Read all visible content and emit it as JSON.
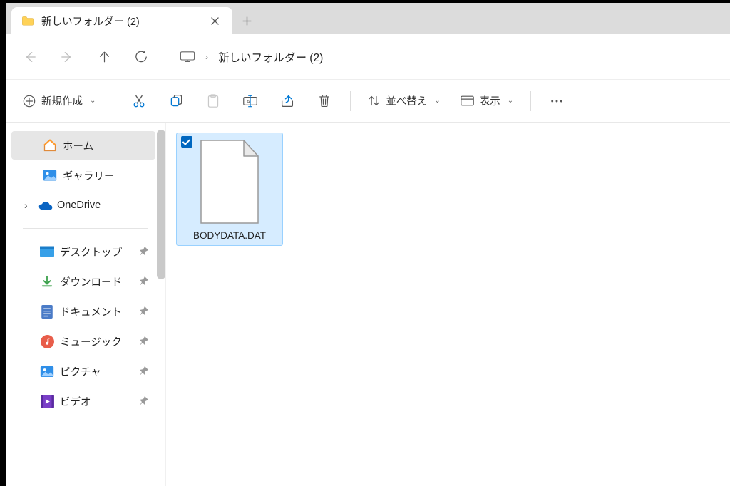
{
  "tab": {
    "title": "新しいフォルダー (2)"
  },
  "breadcrumb": {
    "current": "新しいフォルダー (2)"
  },
  "toolbar": {
    "new": "新規作成",
    "sort": "並べ替え",
    "view": "表示"
  },
  "sidebar": {
    "home": "ホーム",
    "gallery": "ギャラリー",
    "onedrive": "OneDrive",
    "quick": [
      {
        "label": "デスクトップ"
      },
      {
        "label": "ダウンロード"
      },
      {
        "label": "ドキュメント"
      },
      {
        "label": "ミュージック"
      },
      {
        "label": "ピクチャ"
      },
      {
        "label": "ビデオ"
      }
    ]
  },
  "files": [
    {
      "name": "BODYDATA.DAT"
    }
  ]
}
